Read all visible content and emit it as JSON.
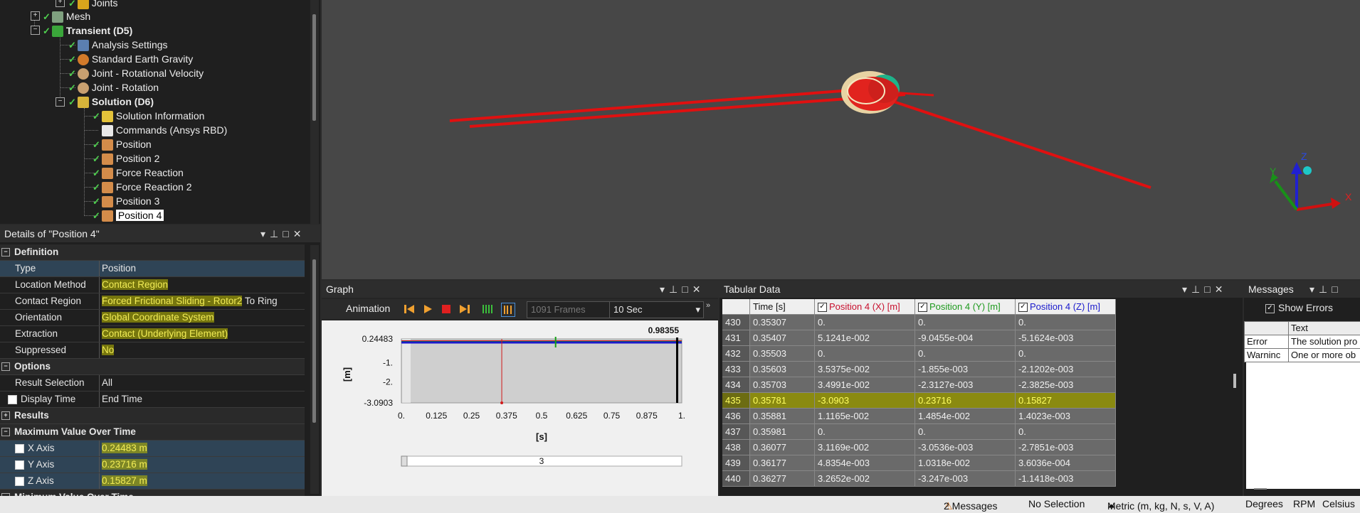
{
  "tree": {
    "items": [
      {
        "label": "Joints",
        "bold": false
      },
      {
        "label": "Mesh",
        "bold": false
      },
      {
        "label": "Transient (D5)",
        "bold": true
      },
      {
        "label": "Analysis Settings",
        "bold": false
      },
      {
        "label": "Standard Earth Gravity",
        "bold": false
      },
      {
        "label": "Joint - Rotational Velocity",
        "bold": false
      },
      {
        "label": "Joint - Rotation",
        "bold": false
      },
      {
        "label": "Solution (D6)",
        "bold": true
      },
      {
        "label": "Solution Information",
        "bold": false
      },
      {
        "label": "Commands (Ansys RBD)",
        "bold": false
      },
      {
        "label": "Position",
        "bold": false
      },
      {
        "label": "Position 2",
        "bold": false
      },
      {
        "label": "Force Reaction",
        "bold": false
      },
      {
        "label": "Force Reaction 2",
        "bold": false
      },
      {
        "label": "Position 3",
        "bold": false
      },
      {
        "label": "Position 4",
        "bold": false
      }
    ]
  },
  "details": {
    "title": "Details of \"Position 4\"",
    "sections": {
      "definition": "Definition",
      "options": "Options",
      "results": "Results",
      "max_over_time": "Maximum Value Over Time",
      "min_over_time": "Minimum Value Over Time"
    },
    "rows": {
      "type": {
        "label": "Type",
        "value": "Position"
      },
      "location_method": {
        "label": "Location Method",
        "value": "Contact Region"
      },
      "contact_region": {
        "label": "Contact Region",
        "value": "Forced Frictional Sliding - Rotor2",
        "suffix": "To Ring"
      },
      "orientation": {
        "label": "Orientation",
        "value": "Global Coordinate System"
      },
      "extraction": {
        "label": "Extraction",
        "value": "Contact (Underlying Element)"
      },
      "suppressed": {
        "label": "Suppressed",
        "value": "No"
      },
      "result_selection": {
        "label": "Result Selection",
        "value": "All"
      },
      "display_time": {
        "label": "Display Time",
        "value": "End Time"
      },
      "x_axis": {
        "label": "X Axis",
        "value": "0.24483 m"
      },
      "y_axis": {
        "label": "Y Axis",
        "value": "0.23716 m"
      },
      "z_axis": {
        "label": "Z Axis",
        "value": "0.15827 m"
      }
    }
  },
  "graph": {
    "title": "Graph",
    "animation_label": "Animation",
    "frames": "1091 Frames",
    "duration": "10 Sec",
    "slider_value": "3",
    "chart_data": {
      "type": "line",
      "ylabel": "[m]",
      "xlabel": "[s]",
      "y_ticks": [
        "0.24483",
        "-1.",
        "-2.",
        "-3.0903"
      ],
      "x_ticks": [
        "0.",
        "0.125",
        "0.25",
        "0.375",
        "0.5",
        "0.625",
        "0.75",
        "0.875",
        "1."
      ],
      "current_time": "0.98355",
      "ylim": [
        -3.0903,
        0.24483
      ],
      "xlim": [
        0,
        1
      ],
      "colors": {
        "x": "#d11a1a",
        "y": "#15a015",
        "z": "#1a1acc",
        "time": "#000000"
      }
    }
  },
  "tabular": {
    "title": "Tabular Data",
    "columns": [
      "Time [s]",
      "Position 4 (X) [m]",
      "Position 4 (Y) [m]",
      "Position 4 (Z) [m]"
    ],
    "column_colors": [
      "#111111",
      "#c8102e",
      "#1e9a1e",
      "#1a1acc"
    ],
    "highlight_index": "435",
    "rows": [
      [
        "430",
        "0.35307",
        "0.",
        "0.",
        "0."
      ],
      [
        "431",
        "0.35407",
        "5.1241e-002",
        "-9.0455e-004",
        "-5.1624e-003"
      ],
      [
        "432",
        "0.35503",
        "0.",
        "0.",
        "0."
      ],
      [
        "433",
        "0.35603",
        "3.5375e-002",
        "-1.855e-003",
        "-2.1202e-003"
      ],
      [
        "434",
        "0.35703",
        "3.4991e-002",
        "-2.3127e-003",
        "-2.3825e-003"
      ],
      [
        "435",
        "0.35781",
        "-3.0903",
        "0.23716",
        "0.15827"
      ],
      [
        "436",
        "0.35881",
        "1.1165e-002",
        "1.4854e-002",
        "1.4023e-003"
      ],
      [
        "437",
        "0.35981",
        "0.",
        "0.",
        "0."
      ],
      [
        "438",
        "0.36077",
        "3.1169e-002",
        "-3.0536e-003",
        "-2.7851e-003"
      ],
      [
        "439",
        "0.36177",
        "4.8354e-003",
        "1.0318e-002",
        "3.6036e-004"
      ],
      [
        "440",
        "0.36277",
        "3.2652e-002",
        "-3.247e-003",
        "-1.1418e-003"
      ]
    ]
  },
  "messages": {
    "title": "Messages",
    "show_errors": "Show Errors",
    "col_text": "Text",
    "items": [
      {
        "type": "Error",
        "text": "The solution pro"
      },
      {
        "type": "Warninc",
        "text": "One or more ob"
      }
    ]
  },
  "status": {
    "messages": "2 Messages",
    "selection": "No Selection",
    "units": "Metric (m, kg, N, s, V, A)",
    "angle": "Degrees",
    "rpm": "RPM",
    "temp": "Celsius"
  },
  "triad": {
    "x": "X",
    "y": "Y",
    "z": "Z"
  }
}
